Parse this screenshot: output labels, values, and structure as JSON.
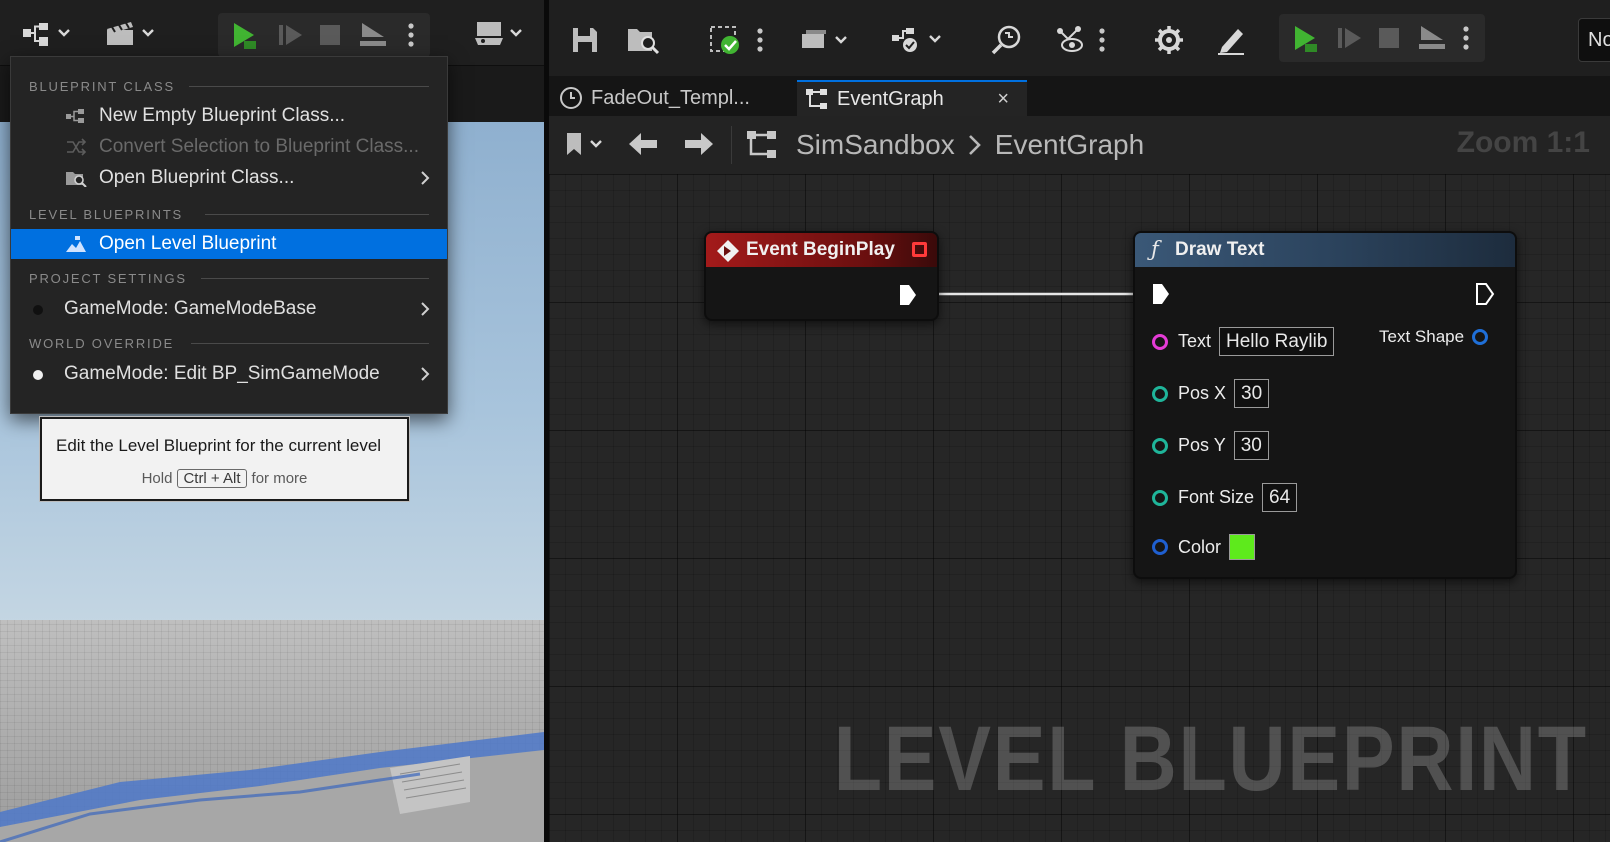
{
  "left_toolbar": {
    "icons": [
      "blueprint-menu-icon",
      "cinematics-icon",
      "play-icon",
      "advance-frame-icon",
      "stop-icon",
      "eject-icon",
      "more-options-icon",
      "platforms-icon"
    ]
  },
  "menu": {
    "sections": {
      "blueprint_class": "BLUEPRINT CLASS",
      "level_blueprints": "LEVEL BLUEPRINTS",
      "project_settings": "PROJECT SETTINGS",
      "world_override": "WORLD OVERRIDE"
    },
    "items": {
      "new_empty": "New Empty Blueprint Class...",
      "convert_selection": "Convert Selection to Blueprint Class...",
      "open_blueprint_class": "Open Blueprint Class...",
      "open_level_blueprint": "Open Level Blueprint",
      "gamemode_base": "GameMode: GameModeBase",
      "gamemode_edit": "GameMode: Edit BP_SimGameMode"
    }
  },
  "tooltip": {
    "text": "Edit the Level Blueprint for the current level",
    "hold": "Hold",
    "key": "Ctrl + Alt",
    "more": "for more"
  },
  "editor_toolbar": {
    "partial_label": "No"
  },
  "tabs": [
    {
      "label": "FadeOut_Templ...",
      "icon": "clock-icon"
    },
    {
      "label": "EventGraph",
      "icon": "graph-icon",
      "close": "×"
    }
  ],
  "breadcrumb": {
    "root": "SimSandbox",
    "separator": ">",
    "current": "EventGraph",
    "zoom": "Zoom 1:1"
  },
  "graph": {
    "watermark": "LEVEL BLUEPRINT",
    "event_node": {
      "title": "Event BeginPlay"
    },
    "draw_text_node": {
      "title": "Draw Text",
      "func_glyph": "ƒ",
      "pins": {
        "text_label": "Text",
        "text_value": "Hello Raylib",
        "text_shape": "Text Shape",
        "pos_x_label": "Pos X",
        "pos_x_value": "30",
        "pos_y_label": "Pos Y",
        "pos_y_value": "30",
        "font_size_label": "Font Size",
        "font_size_value": "64",
        "color_label": "Color"
      },
      "color_value_hex": "#5eea1c"
    }
  },
  "colors": {
    "selection": "#0070e0",
    "play": "#41b432",
    "event_header": "#8e1414",
    "function_header": "#2f4a66"
  }
}
